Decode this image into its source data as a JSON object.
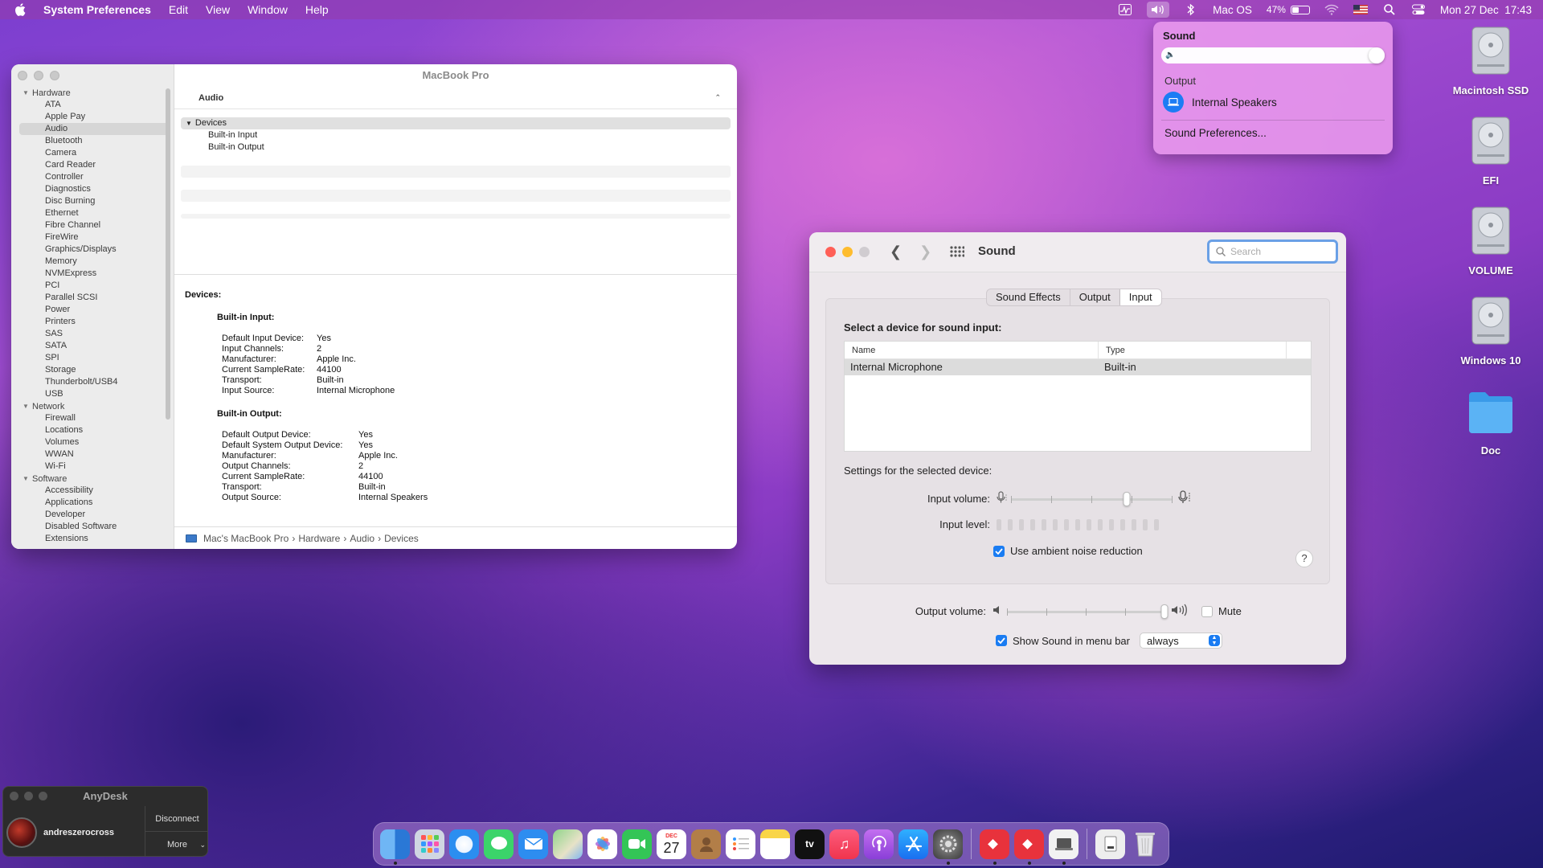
{
  "menubar": {
    "app_name": "System Preferences",
    "menus": [
      "Edit",
      "View",
      "Window",
      "Help"
    ],
    "user_label": "Mac OS",
    "battery_percent": "47%",
    "battery_level": 0.47,
    "datetime": "Mon 27 Dec  17:43"
  },
  "sound_menu": {
    "title": "Sound",
    "volume_level": 1.0,
    "output_heading": "Output",
    "device": "Internal Speakers",
    "prefs_link": "Sound Preferences..."
  },
  "desktop_icons": [
    {
      "label": "Macintosh SSD",
      "type": "disk"
    },
    {
      "label": "EFI",
      "type": "disk"
    },
    {
      "label": "VOLUME",
      "type": "disk"
    },
    {
      "label": "Windows 10",
      "type": "disk"
    },
    {
      "label": "Doc",
      "type": "folder"
    }
  ],
  "sysinfo": {
    "window_title": "MacBook Pro",
    "sidebar": {
      "hardware_label": "Hardware",
      "hardware_items": [
        "ATA",
        "Apple Pay",
        "Audio",
        "Bluetooth",
        "Camera",
        "Card Reader",
        "Controller",
        "Diagnostics",
        "Disc Burning",
        "Ethernet",
        "Fibre Channel",
        "FireWire",
        "Graphics/Displays",
        "Memory",
        "NVMExpress",
        "PCI",
        "Parallel SCSI",
        "Power",
        "Printers",
        "SAS",
        "SATA",
        "SPI",
        "Storage",
        "Thunderbolt/USB4",
        "USB"
      ],
      "network_label": "Network",
      "network_items": [
        "Firewall",
        "Locations",
        "Volumes",
        "WWAN",
        "Wi-Fi"
      ],
      "software_label": "Software",
      "software_items": [
        "Accessibility",
        "Applications",
        "Developer",
        "Disabled Software",
        "Extensions"
      ],
      "selected": "Audio"
    },
    "header": "Audio",
    "tree": {
      "root": "Devices",
      "children": [
        "Built-in Input",
        "Built-in Output"
      ]
    },
    "detail": {
      "heading": "Devices:",
      "input_heading": "Built-in Input:",
      "input_rows": [
        {
          "k": "Default Input Device:",
          "v": "Yes"
        },
        {
          "k": "Input Channels:",
          "v": "2"
        },
        {
          "k": "Manufacturer:",
          "v": "Apple Inc."
        },
        {
          "k": "Current SampleRate:",
          "v": "44100"
        },
        {
          "k": "Transport:",
          "v": "Built-in"
        },
        {
          "k": "Input Source:",
          "v": "Internal Microphone"
        }
      ],
      "output_heading": "Built-in Output:",
      "output_rows": [
        {
          "k": "Default Output Device:",
          "v": "Yes"
        },
        {
          "k": "Default System Output Device:",
          "v": "Yes"
        },
        {
          "k": "Manufacturer:",
          "v": "Apple Inc."
        },
        {
          "k": "Output Channels:",
          "v": "2"
        },
        {
          "k": "Current SampleRate:",
          "v": "44100"
        },
        {
          "k": "Transport:",
          "v": "Built-in"
        },
        {
          "k": "Output Source:",
          "v": "Internal Speakers"
        }
      ]
    },
    "path": [
      "Mac's MacBook Pro",
      "Hardware",
      "Audio",
      "Devices"
    ]
  },
  "sound_window": {
    "title": "Sound",
    "search_placeholder": "Search",
    "tabs": [
      "Sound Effects",
      "Output",
      "Input"
    ],
    "active_tab": "Input",
    "select_label": "Select a device for sound input:",
    "table_headers": [
      "Name",
      "Type"
    ],
    "table_rows": [
      {
        "name": "Internal Microphone",
        "type": "Built-in"
      }
    ],
    "settings_label": "Settings for the selected device:",
    "input_volume_label": "Input volume:",
    "input_volume_level": 0.72,
    "input_level_label": "Input level:",
    "ambient_label": "Use ambient noise reduction",
    "ambient_checked": true,
    "help_label": "?",
    "output_volume_label": "Output volume:",
    "output_volume_level": 1.0,
    "mute_label": "Mute",
    "mute_checked": false,
    "show_menu_label": "Show Sound in menu bar",
    "show_menu_checked": true,
    "show_menu_option": "always"
  },
  "anydesk": {
    "title": "AnyDesk",
    "user": "andreszerocross",
    "disconnect": "Disconnect",
    "more": "More"
  },
  "dock": {
    "calendar_month": "DEC",
    "calendar_day": "27",
    "tv_label": "tv"
  }
}
